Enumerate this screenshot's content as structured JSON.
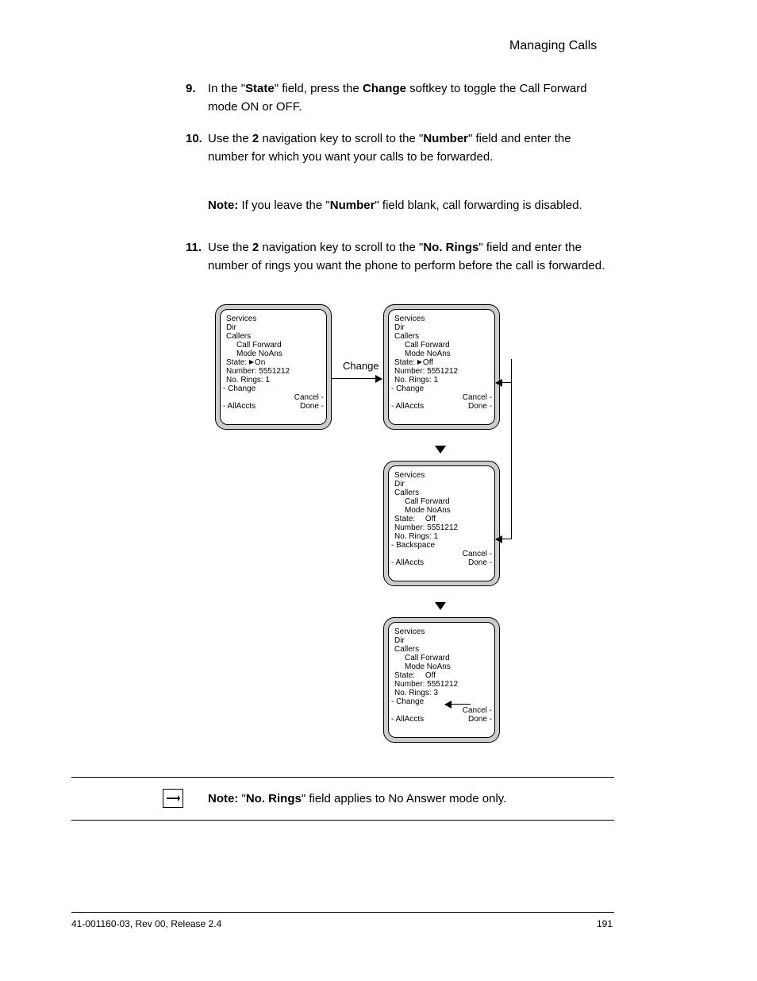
{
  "header": {
    "title": "Managing Calls"
  },
  "steps": {
    "s9_label": "9.",
    "s9_text_a": "In the \"",
    "s9_bold_a": "State",
    "s9_text_b": "\" field, press the ",
    "s9_bold_b": "Change ",
    "s9_text_c": "softkey to toggle the Call Forward mode ON or OFF.",
    "s10_label": "10.",
    "s10_text_a": "Use the ",
    "s10_bold_a": "2",
    "s10_text_b": " navigation key to scroll to the \"",
    "s10_bold_b": "Number",
    "s10_text_c": "\" field and enter the number for which you want your calls to be forwarded.",
    "s11_note_prefix": "Note: ",
    "s11_note_body": "If you leave the \"",
    "s11_note_bold": "Number",
    "s11_note_body2": "\" field blank, call forwarding is disabled.",
    "s11_label": "11.",
    "s11_text_a": "Use the ",
    "s11_bold_a": "2",
    "s11_text_b": " navigation key to scroll to the \"",
    "s11_bold_b": "No. Rings",
    "s11_text_c": "\" field and enter the number of rings you want the phone to perform before the call is forwarded."
  },
  "change_label": "Change",
  "screen_common": {
    "services": "Services",
    "dir": "Dir",
    "callers": "Callers",
    "call_forward": "Call Forward",
    "mode": "Mode NoAns",
    "allaccts": "- AllAccts",
    "cancel": "Cancel -",
    "done": "Done -"
  },
  "screens": [
    {
      "state_label": "State:",
      "state_ptr": true,
      "state_val": "On",
      "number_label": "Number:",
      "number_val": "5551212",
      "rings_label": "No. Rings:",
      "rings_val": "1",
      "leftmid": "- Change"
    },
    {
      "state_label": "State:",
      "state_ptr": true,
      "state_val": "Off",
      "number_label": "Number:",
      "number_val": "5551212",
      "rings_label": "No. Rings:",
      "rings_val": "1",
      "leftmid": "- Change"
    },
    {
      "state_label": "State:",
      "state_ptr": false,
      "state_val": "Off",
      "number_label": "Number:",
      "number_val": "5551212",
      "rings_label": "No. Rings:",
      "rings_val": "1",
      "leftmid": "- Backspace"
    },
    {
      "state_label": "State:",
      "state_ptr": false,
      "state_val": "Off",
      "number_label": "Number:",
      "number_val": "5551212",
      "rings_label": "No. Rings:",
      "rings_val": "3",
      "leftmid": "- Change"
    }
  ],
  "note2": {
    "prefix": "Note: ",
    "body_a": "\"",
    "bold_a": "No. Rings",
    "body_b": "\" field applies to No Answer mode only."
  },
  "footer": {
    "left": "41-001160-03, Rev 00, Release 2.4",
    "right": "191"
  }
}
